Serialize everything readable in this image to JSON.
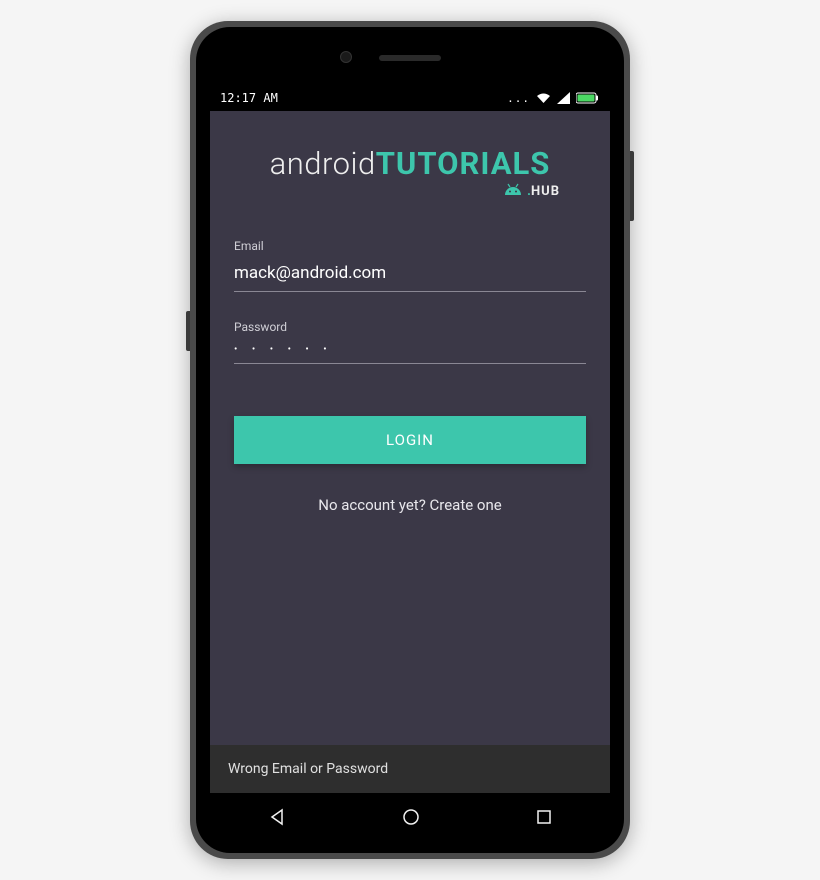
{
  "status": {
    "time": "12:17 AM"
  },
  "logo": {
    "part1": "android",
    "part2": "TUTORIALS",
    "dot": ".",
    "hub": "HUB"
  },
  "form": {
    "email_label": "Email",
    "email_value": "mack@android.com",
    "password_label": "Password",
    "password_value": "• • • • • •",
    "login_button": "LOGIN",
    "create_account": "No account yet? Create one"
  },
  "snackbar": {
    "message": "Wrong Email or Password"
  }
}
